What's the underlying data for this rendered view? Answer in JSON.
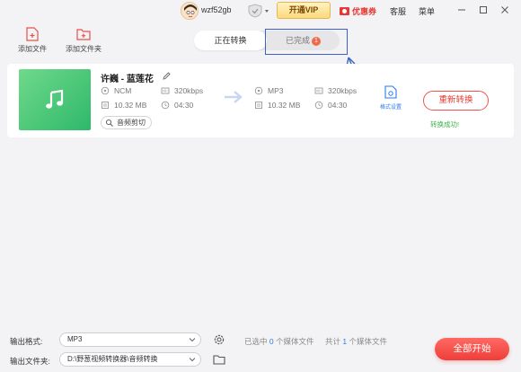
{
  "topbar": {
    "username": "wzf52gb",
    "vip_label": "开通VIP",
    "coupon_label": "优惠券",
    "service_label": "客服",
    "menu_label": "菜单"
  },
  "toolbar": {
    "add_file": "添加文件",
    "add_folder": "添加文件夹"
  },
  "tabs": {
    "converting": "正在转换",
    "completed": "已完成",
    "completed_count": "1"
  },
  "file": {
    "name": "许巍 - 蓝莲花",
    "source": {
      "format": "NCM",
      "bitrate": "320kbps",
      "size": "10.32 MB",
      "duration": "04:30"
    },
    "target": {
      "format": "MP3",
      "bitrate": "320kbps",
      "size": "10.32 MB",
      "duration": "04:30"
    },
    "audio_cut_label": "音频剪切",
    "format_settings_label": "格式设置",
    "reconvert_label": "重新转换",
    "status": "转换成功!"
  },
  "bottom": {
    "output_format_label": "输出格式:",
    "output_format_value": "MP3",
    "output_folder_label": "输出文件夹:",
    "output_folder_value": "D:\\野葱视频转换器\\音频转换",
    "selected_prefix": "已选中",
    "selected_count": "0",
    "selected_suffix": "个媒体文件",
    "total_prefix": "共计",
    "total_count": "1",
    "total_suffix": "个媒体文件",
    "start_all_label": "全部开始"
  },
  "colors": {
    "accent_red": "#ef3e3a",
    "link_blue": "#2c7be5",
    "success_green": "#3cb34a",
    "highlight_blue": "#3a62c9"
  }
}
